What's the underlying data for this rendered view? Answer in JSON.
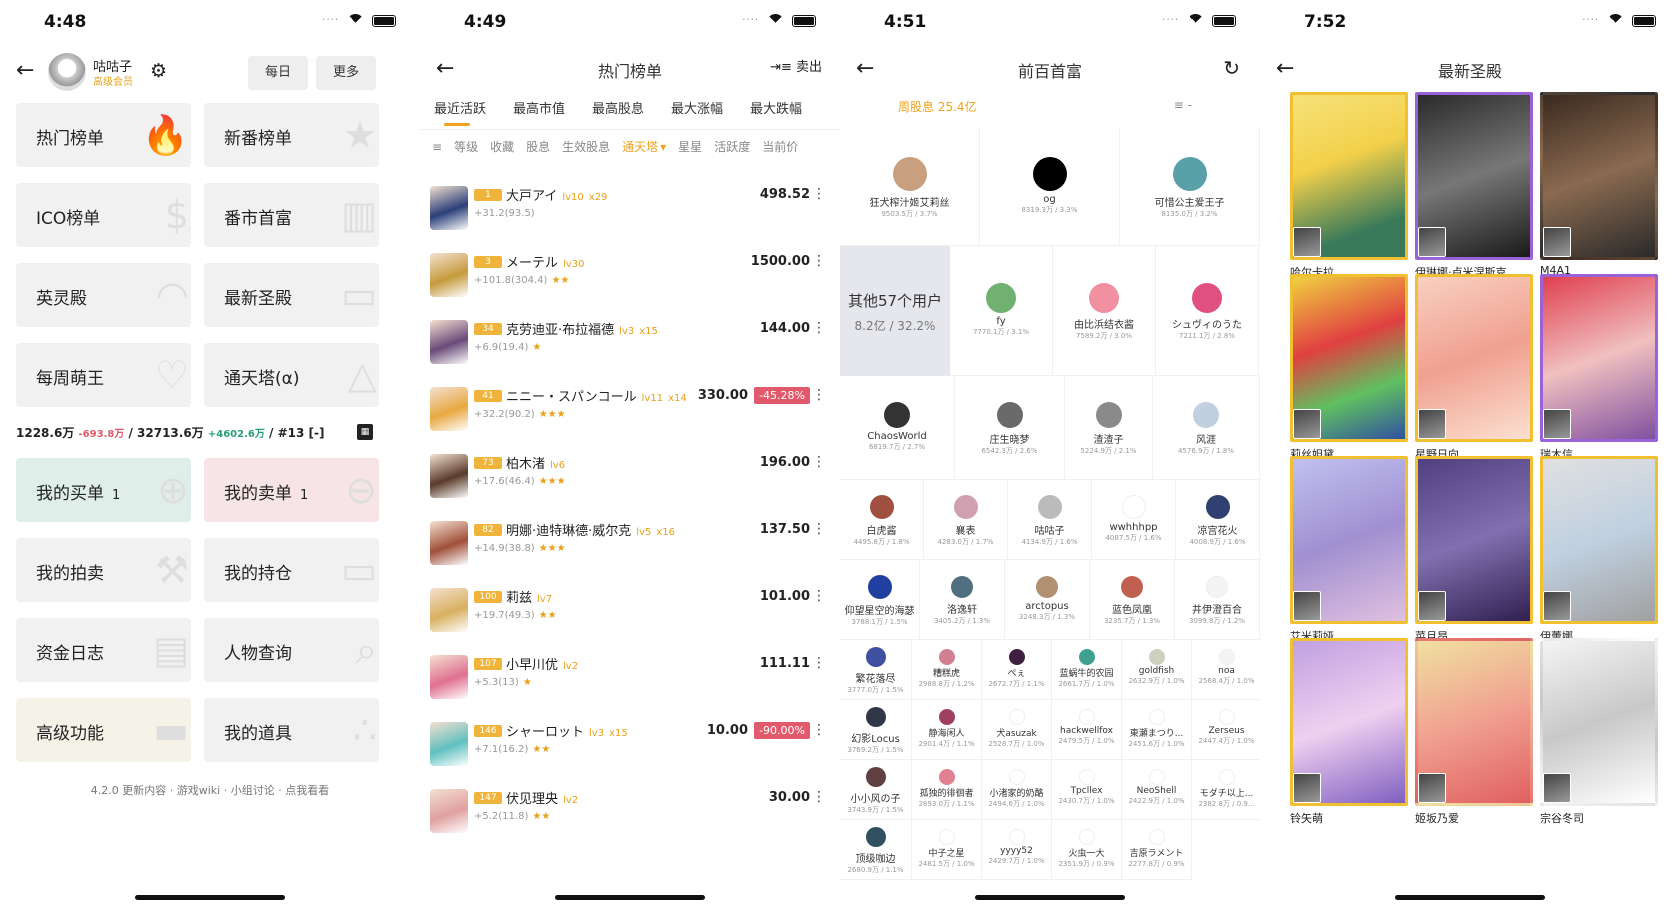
{
  "screen1": {
    "time": "4:48",
    "user_name": "咕咕子",
    "user_badge": "高级会员",
    "daily_btn": "每日",
    "more_btn": "更多",
    "tiles": [
      {
        "label": "热门榜单",
        "icon": "🔥"
      },
      {
        "label": "新番榜单",
        "icon": "★"
      },
      {
        "label": "ICO榜单",
        "icon": "$"
      },
      {
        "label": "番市首富",
        "icon": "▥"
      },
      {
        "label": "英灵殿",
        "icon": "◠"
      },
      {
        "label": "最新圣殿",
        "icon": "▭"
      },
      {
        "label": "每周萌王",
        "icon": "♡"
      },
      {
        "label": "通天塔(α)",
        "icon": "△"
      }
    ],
    "stats": {
      "balance": "1228.6万",
      "balance_change": "-693.8万",
      "assets": "/ 32713.6万",
      "assets_change": "+4602.6万",
      "rank": "/ #13 [-]"
    },
    "tiles2": [
      {
        "label": "我的买单",
        "count": "1",
        "icon": "⊕"
      },
      {
        "label": "我的卖单",
        "count": "1",
        "icon": "⊖"
      },
      {
        "label": "我的拍卖",
        "count": "",
        "icon": "⚒"
      },
      {
        "label": "我的持仓",
        "count": "",
        "icon": "▭"
      },
      {
        "label": "资金日志",
        "count": "",
        "icon": "▤"
      },
      {
        "label": "人物查询",
        "count": "",
        "icon": "⌕"
      },
      {
        "label": "高级功能",
        "count": "",
        "icon": "▬"
      },
      {
        "label": "我的道具",
        "count": "",
        "icon": "∴"
      }
    ],
    "footer": "4.2.0 更新内容 · 游戏wiki · 小组讨论 · 点我看看"
  },
  "screen2": {
    "time": "4:49",
    "title": "热门榜单",
    "sell": "卖出",
    "tabs": [
      "最近活跃",
      "最高市值",
      "最高股息",
      "最大涨幅",
      "最大跌幅"
    ],
    "filters": [
      "等级",
      "收藏",
      "股息",
      "生效股息",
      "通天塔",
      "星星",
      "活跃度",
      "当前价"
    ],
    "rows": [
      {
        "rank": "1",
        "name": "大戸アイ",
        "lv": "lv10",
        "extra": "x29",
        "sub": "+31.2(93.5)",
        "stars": "",
        "price": "498.52",
        "change": "",
        "color": "#2b3f7a"
      },
      {
        "rank": "3",
        "name": "メーテル",
        "lv": "lv30",
        "extra": "",
        "sub": "+101.8(304.4)",
        "stars": "★★",
        "price": "1500.00",
        "change": "",
        "color": "#c59a3c"
      },
      {
        "rank": "34",
        "name": "克劳迪亚·布拉福德",
        "lv": "lv3",
        "extra": "x15",
        "sub": "+6.9(19.4)",
        "stars": "★",
        "price": "144.00",
        "change": "",
        "color": "#6a4a7a"
      },
      {
        "rank": "41",
        "name": "ニニー・スパンコール",
        "lv": "lv11",
        "extra": "x14",
        "sub": "+32.2(90.2)",
        "stars": "★★★",
        "price": "330.00",
        "change": "-45.28%",
        "color": "#e8a840"
      },
      {
        "rank": "73",
        "name": "柏木渚",
        "lv": "lv6",
        "extra": "",
        "sub": "+17.6(46.4)",
        "stars": "★★★",
        "price": "196.00",
        "change": "",
        "color": "#5a3a2a"
      },
      {
        "rank": "82",
        "name": "明娜·迪特琳德·威尔克",
        "lv": "lv5",
        "extra": "x16",
        "sub": "+14.9(38.8)",
        "stars": "★★★",
        "price": "137.50",
        "change": "",
        "color": "#a0503a"
      },
      {
        "rank": "100",
        "name": "莉兹",
        "lv": "lv7",
        "extra": "",
        "sub": "+19.7(49.3)",
        "stars": "★★",
        "price": "101.00",
        "change": "",
        "color": "#d8b060"
      },
      {
        "rank": "107",
        "name": "小早川优",
        "lv": "lv2",
        "extra": "",
        "sub": "+5.3(13)",
        "stars": "★",
        "price": "111.11",
        "change": "",
        "color": "#e07090"
      },
      {
        "rank": "146",
        "name": "シャーロット",
        "lv": "lv3",
        "extra": "x15",
        "sub": "+7.1(16.2)",
        "stars": "★★",
        "price": "10.00",
        "change": "-90.00%",
        "color": "#60c0c0"
      },
      {
        "rank": "147",
        "name": "伏见理央",
        "lv": "lv2",
        "extra": "",
        "sub": "+5.2(11.8)",
        "stars": "★★",
        "price": "30.00",
        "change": "",
        "color": "#e0a0a0"
      }
    ]
  },
  "screen3": {
    "time": "4:51",
    "title": "前百首富",
    "weekly": "周股息 25.4亿",
    "filter": "-",
    "others_name": "其他57个用户",
    "others_value": "8.2亿 / 32.2%",
    "users": [
      {
        "name": "狂犬榨汁姬艾莉丝",
        "value": "9503.5万 / 3.7%",
        "color": "#c8a080"
      },
      {
        "name": "og",
        "value": "8319.3万 / 3.3%",
        "color": "#000000"
      },
      {
        "name": "可惜公主爱王子",
        "value": "8135.0万 / 3.2%",
        "color": "#5aa0a8"
      },
      {
        "name": "fy",
        "value": "7770.1万 / 3.1%",
        "color": "#70b070"
      },
      {
        "name": "由比浜结衣酱",
        "value": "7589.2万 / 3.0%",
        "color": "#f090a0"
      },
      {
        "name": "シュヴィのうた",
        "value": "7211.1万 / 2.8%",
        "color": "#e05080"
      },
      {
        "name": "ChaosWorld",
        "value": "6819.7万 / 2.7%",
        "color": "#333333"
      },
      {
        "name": "庄生晓梦",
        "value": "6542.3万 / 2.6%",
        "color": "#6a6a6a"
      },
      {
        "name": "渣渣子",
        "value": "5224.9万 / 2.1%",
        "color": "#8a8a8a"
      },
      {
        "name": "风涯",
        "value": "4576.9万 / 1.8%",
        "color": "#c0d0e0"
      },
      {
        "name": "白虎酱",
        "value": "4495.8万 / 1.8%",
        "color": "#a05040"
      },
      {
        "name": "襄表",
        "value": "4283.0万 / 1.7%",
        "color": "#d0a0b0"
      },
      {
        "name": "咕咕子",
        "value": "4134.9万 / 1.6%",
        "color": "#bbbbbb"
      },
      {
        "name": "wwhhhpp",
        "value": "4087.5万 / 1.6%",
        "color": "#ffffff"
      },
      {
        "name": "凉宫花火",
        "value": "4008.9万 / 1.6%",
        "color": "#304070"
      },
      {
        "name": "仰望星空的海瑟",
        "value": "3788.1万 / 1.5%",
        "color": "#2040a0"
      },
      {
        "name": "洛逸轩",
        "value": "3405.2万 / 1.3%",
        "color": "#507080"
      },
      {
        "name": "arctopus",
        "value": "3248.3万 / 1.3%",
        "color": "#b09070"
      },
      {
        "name": "蓝色凤凰",
        "value": "3235.7万 / 1.3%",
        "color": "#c06050"
      },
      {
        "name": "井伊澄百合",
        "value": "3099.8万 / 1.2%",
        "color": "#f4f4f4"
      },
      {
        "name": "繁花落尽",
        "value": "3777.0万 / 1.5%",
        "color": "#4050a0"
      },
      {
        "name": "糟糕虎",
        "value": "2988.8万 / 1.2%",
        "color": "#d08090"
      },
      {
        "name": "ぺぇ",
        "value": "2672.7万 / 1.1%",
        "color": "#402040"
      },
      {
        "name": "蓝蜗牛的农园",
        "value": "2661.7万 / 1.0%",
        "color": "#40a090"
      },
      {
        "name": "goldfish",
        "value": "2632.9万 / 1.0%",
        "color": "#d0d0c0"
      },
      {
        "name": "noa",
        "value": "2568.4万 / 1.0%",
        "color": "#f4f4f4"
      },
      {
        "name": "幻影Locus",
        "value": "3769.2万 / 1.5%",
        "color": "#303848"
      },
      {
        "name": "静海闲人",
        "value": "2901.4万 / 1.1%",
        "color": "#a04060"
      },
      {
        "name": "犬asuzak",
        "value": "2528.7万 / 1.0%",
        "color": "#ffffff"
      },
      {
        "name": "hackwellfox",
        "value": "2479.5万 / 1.0%",
        "color": "#ffffff"
      },
      {
        "name": "東瀬まつり...",
        "value": "2451.6万 / 1.0%",
        "color": "#ffffff"
      },
      {
        "name": "Zerseus",
        "value": "2447.4万 / 1.0%",
        "color": "#ffffff"
      },
      {
        "name": "小小风の子",
        "value": "3743.9万 / 1.5%",
        "color": "#604040"
      },
      {
        "name": "孤独的徘徊者",
        "value": "2893.0万 / 1.1%",
        "color": "#e08090"
      },
      {
        "name": "小渚家的奶酪",
        "value": "2494.6万 / 1.0%",
        "color": "#ffffff"
      },
      {
        "name": "Tpcllex",
        "value": "2430.7万 / 1.0%",
        "color": "#ffffff"
      },
      {
        "name": "NeoShell",
        "value": "2422.9万 / 1.0%",
        "color": "#ffffff"
      },
      {
        "name": "モダチ以上...",
        "value": "2382.8万 / 0.9...",
        "color": "#ffffff"
      },
      {
        "name": "顶级咖边",
        "value": "2680.9万 / 1.1%",
        "color": "#305060"
      },
      {
        "name": "中子之星",
        "value": "2481.5万 / 1.0%",
        "color": "#ffffff"
      },
      {
        "name": "yyyy52",
        "value": "2429.7万 / 1.0%",
        "color": "#ffffff"
      },
      {
        "name": "火虫一大",
        "value": "2351.9万 / 0.9%",
        "color": "#ffffff"
      },
      {
        "name": "吉原ラメント",
        "value": "2277.8万 / 0.9%",
        "color": "#ffffff"
      }
    ]
  },
  "screen4": {
    "time": "7:52",
    "title": "最新圣殿",
    "cards": [
      {
        "name": "哈尔卡拉",
        "frame": "gold",
        "bg": "linear-gradient(160deg,#f6e27a,#f3d04a 40%,#3a7a5a 80%)"
      },
      {
        "name": "伊琳娜·卢米涅斯克",
        "frame": "purple",
        "bg": "linear-gradient(160deg,#2a2a2a,#777 50%,#1a1a1a)"
      },
      {
        "name": "M4A1",
        "frame": "",
        "bg": "linear-gradient(160deg,#3a2a20,#8a6a50 50%,#2a2a2a)"
      },
      {
        "name": "莉丝妲黛",
        "frame": "gold",
        "bg": "linear-gradient(160deg,#f0d040,#e04040 40%,#60c060 70%,#3050a0)"
      },
      {
        "name": "星野日向",
        "frame": "gold",
        "bg": "linear-gradient(160deg,#f8d0c0,#f0a090 50%,#fbe0d0)"
      },
      {
        "name": "瑞木信",
        "frame": "purple",
        "bg": "linear-gradient(160deg,#e04050,#f0c0c0 50%,#8050a0)"
      },
      {
        "name": "艾米莉娅",
        "frame": "gold",
        "bg": "linear-gradient(160deg,#c0c0f0,#a090d0 50%,#e0c0e0)"
      },
      {
        "name": "菜月昂",
        "frame": "gold",
        "bg": "linear-gradient(160deg,#504080,#8070b0 50%,#302050)"
      },
      {
        "name": "伊蕾娜",
        "frame": "gold",
        "bg": "linear-gradient(160deg,#e0e0e0,#c0d0e0 50%,#a0a0a0)"
      },
      {
        "name": "铃矢萌",
        "frame": "gold",
        "bg": "linear-gradient(160deg,#c0a0e0,#f0d0f0 50%,#8060c0)"
      },
      {
        "name": "姬坂乃爱",
        "frame": "",
        "bg": "linear-gradient(160deg,#f0e0a0,#f0a090 50%,#e06060)"
      },
      {
        "name": "宗谷冬司",
        "frame": "",
        "bg": "linear-gradient(160deg,#f4f4f4,#c8c8c8 50%,#ffffff)"
      }
    ]
  }
}
